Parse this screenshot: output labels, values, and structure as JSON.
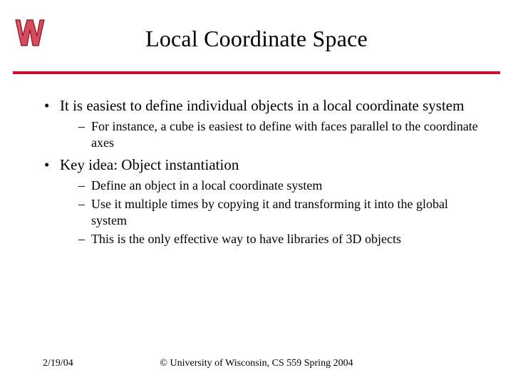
{
  "slide": {
    "title": "Local Coordinate Space",
    "bullets": [
      {
        "text": "It is easiest to define individual objects in a local coordinate system",
        "sub": [
          "For instance, a cube is easiest to define with faces parallel to the coordinate axes"
        ]
      },
      {
        "text": "Key idea: Object instantiation",
        "sub": [
          "Define an object in a local coordinate system",
          "Use it multiple times by copying it and transforming it into the global system",
          "This is the only effective way to have libraries of 3D objects"
        ]
      }
    ]
  },
  "footer": {
    "date": "2/19/04",
    "copyright": "© University of Wisconsin, CS 559 Spring 2004"
  },
  "colors": {
    "rule": "#c8102e"
  }
}
